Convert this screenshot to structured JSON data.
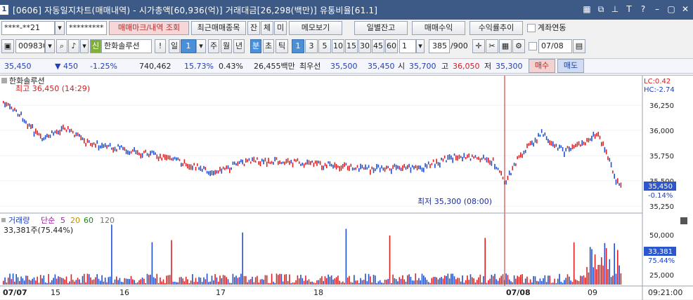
{
  "window": {
    "icon": "1",
    "title": "[0606] 자동일지차트(매매내역) - 시가총액[60,936(억)] 거래대금[26,298(백만)] 유통비율[61.1]",
    "controls": [
      "grid-icon",
      "copy-icon",
      "pin-icon",
      "T",
      "?",
      "minimize-icon",
      "restore-icon",
      "close-icon"
    ]
  },
  "row1": {
    "account": "****-**21",
    "password": "*********",
    "btn_trade_mark": "매매마크/내역 조회",
    "btn_recent": "최근매매종목",
    "btn_jan": "잔",
    "btn_che": "체",
    "btn_mi": "미",
    "btn_memo": "메모보기",
    "btn_daily": "일별잔고",
    "btn_profit": "매매수익",
    "btn_return": "수익률추이",
    "chk_account": "계좌연동"
  },
  "row2": {
    "code": "009830",
    "badge": "신",
    "name": "한화솔루션",
    "excl": "!",
    "period_label": "일",
    "period_val": "1",
    "periods": [
      "주",
      "월",
      "년",
      "분",
      "초",
      "틱"
    ],
    "intervals": [
      "1",
      "3",
      "5",
      "10",
      "15",
      "30",
      "45",
      "60"
    ],
    "interval_val": "1",
    "count": "385",
    "count_total": "/900",
    "date": "07/08"
  },
  "row3": {
    "price": "35,450",
    "change": "▼ 450",
    "pct": "-1.25%",
    "volume": "740,462",
    "vol_pct": "15.73%",
    "turn": "0.43%",
    "amount": "26,455백만",
    "quote": "최우선",
    "ask": "35,500",
    "bid": "35,450",
    "open_l": "시",
    "open": "35,700",
    "high_l": "고",
    "high": "36,050",
    "low_l": "저",
    "low": "35,300",
    "btn_sell": "매수",
    "btn_buy": "매도"
  },
  "chart": {
    "stock_name": "한화솔루션",
    "high_note": "최고 36,450 (14:29)",
    "low_note": "최저 35,300 (08:00)",
    "lc": "LC:0.42",
    "hc": "HC:-2.74",
    "price_ticks": [
      "36,250",
      "36,000",
      "35,750",
      "35,500",
      "35,250"
    ],
    "cur_price": "35,450",
    "cur_pct": "-0.14%",
    "vol_legend": {
      "name": "거래량",
      "ma": "단순",
      "m5": "5",
      "m20": "20",
      "m60": "60",
      "m120": "120"
    },
    "vol_info": "33,381주(75.44%)",
    "vol_ticks": [
      "50,000",
      "25,000"
    ],
    "cur_vol": "33,381",
    "cur_vol_pct": "75.44%",
    "x_labels": [
      "07/07",
      "15",
      "16",
      "17",
      "18",
      "07/08",
      "09"
    ],
    "time": "09:21:00"
  },
  "chart_data": {
    "type": "candlestick",
    "x": [
      "07/07",
      "15",
      "16",
      "17",
      "18",
      "07/08",
      "09"
    ],
    "ylim": [
      35200,
      36500
    ],
    "high": 36450,
    "low": 35300,
    "current": 35450,
    "vol_ylim": [
      0,
      60000
    ]
  }
}
